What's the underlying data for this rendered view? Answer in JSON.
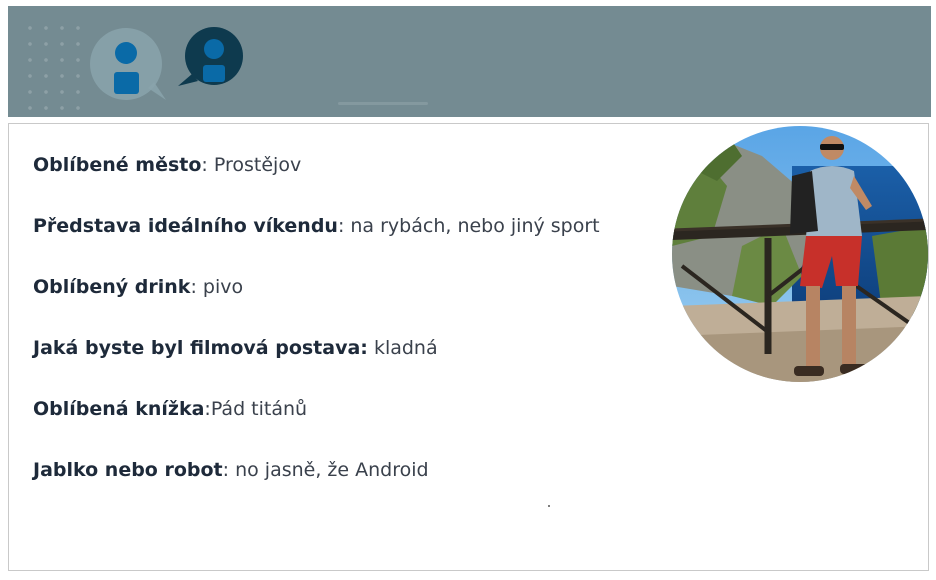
{
  "banner": {
    "logo_icons": [
      "person-chat-icon-light",
      "person-chat-icon-dark"
    ],
    "colors": {
      "background": "#748b92",
      "icon_light": "#0a6aa7",
      "icon_dark": "#0e3a4e"
    }
  },
  "profile": {
    "photo": "man-on-cliff-by-sea-photo",
    "facts": [
      {
        "label": "Oblíbené město",
        "value": ": Prostějov"
      },
      {
        "label": "Představa ideálního víkendu",
        "value": ": na rybách, nebo jiný sport"
      },
      {
        "label": "Oblíbený drink",
        "value": ": pivo"
      },
      {
        "label": "Jaká byste byl filmová postava:",
        "value": " kladná"
      },
      {
        "label": "Oblíbená knížka",
        "value": ":Pád titánů"
      },
      {
        "label": "Jablko nebo robot",
        "value": ": no jasně, že Android"
      }
    ]
  }
}
